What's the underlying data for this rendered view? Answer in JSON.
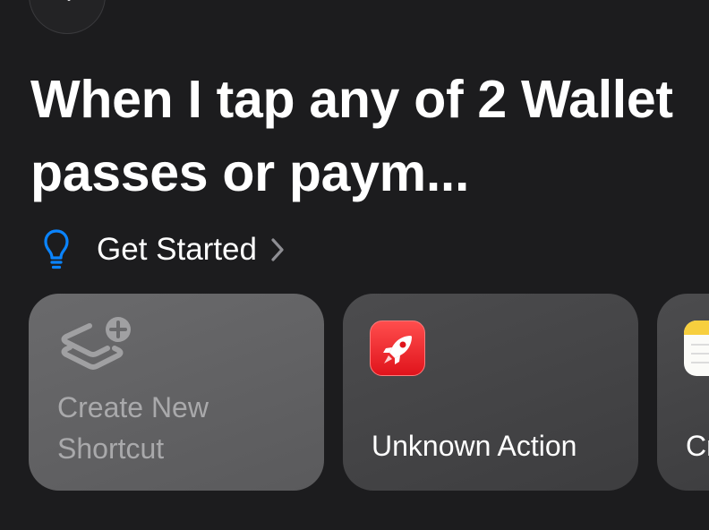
{
  "header": {
    "back_icon": "chevron-left-icon",
    "title": "When I tap any of 2 Wallet passes or paym..."
  },
  "get_started": {
    "label": "Get Started",
    "icon": "lightbulb-icon",
    "accent_color": "#0a84ff"
  },
  "cards": [
    {
      "label": "Create New Shortcut",
      "icon": "layers-plus-icon"
    },
    {
      "label": "Unknown Action",
      "icon": "rocket-icon",
      "tile_color": "#ff3b30"
    },
    {
      "label": "Cr",
      "icon": "notes-icon"
    }
  ]
}
